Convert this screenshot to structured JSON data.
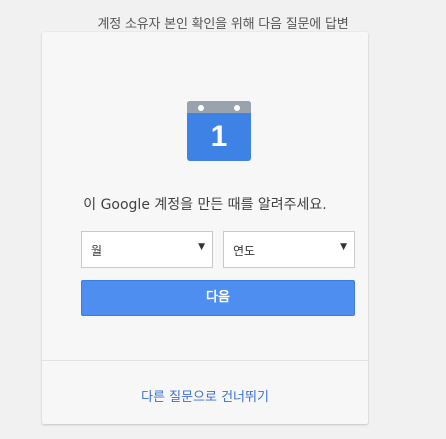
{
  "header": {
    "text": "계정 소유자 본인 확인을 위해 다음 질문에 답변"
  },
  "calendar_icon": {
    "day": "1",
    "icon": "calendar-icon"
  },
  "prompt": {
    "text": "이 Google 계정을 만든 때를 알려주세요."
  },
  "month_select": {
    "selected": "월",
    "arrow": "▼"
  },
  "year_select": {
    "selected": "연도",
    "arrow": "▼"
  },
  "next_button": {
    "label": "다음"
  },
  "skip_link": {
    "label": "다른 질문으로 건너뛰기"
  },
  "colors": {
    "accent": "#4d8ef0",
    "link": "#3a6fd6",
    "calendar": "#3e82e6"
  }
}
